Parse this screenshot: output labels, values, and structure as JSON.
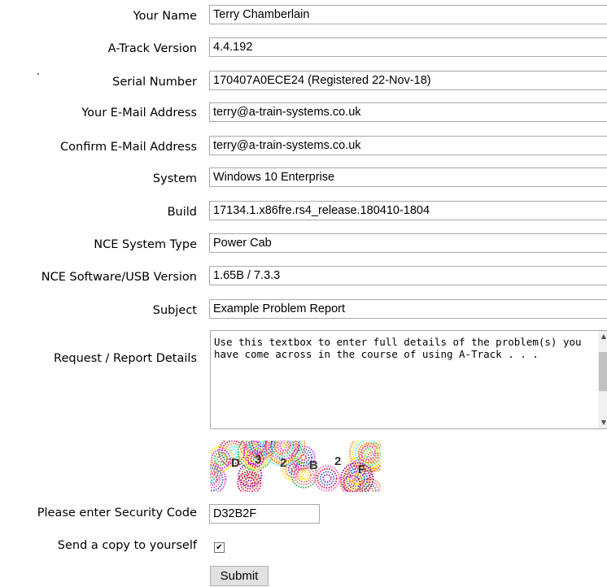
{
  "form": {
    "fields": [
      {
        "label": "Your Name",
        "value": "Terry Chamberlain"
      },
      {
        "label": "A-Track Version",
        "value": "4.4.192"
      },
      {
        "label": "Serial Number",
        "value": "170407A0ECE24 (Registered 22-Nov-18)"
      },
      {
        "label": "Your E-Mail Address",
        "value": "terry@a-train-systems.co.uk"
      },
      {
        "label": "Confirm E-Mail Address",
        "value": "terry@a-train-systems.co.uk"
      },
      {
        "label": "System",
        "value": "Windows 10 Enterprise"
      },
      {
        "label": "Build",
        "value": "17134.1.x86fre.rs4_release.180410-1804"
      },
      {
        "label": "NCE System Type",
        "value": "Power Cab"
      },
      {
        "label": "NCE Software/USB Version",
        "value": "1.65B / 7.3.3"
      },
      {
        "label": "Subject",
        "value": "Example Problem Report"
      }
    ],
    "details": {
      "label": "Request / Report Details",
      "value": "Use this textbox to enter full details of the problem(s) you have come across in the course of using A-Track . . ."
    },
    "captcha": {
      "characters": [
        "D",
        "3",
        "2",
        "B",
        "2",
        "F"
      ],
      "colors": [
        "#e6194b",
        "#3cb44b",
        "#ffe119",
        "#4363d8",
        "#f58231",
        "#911eb4",
        "#46f0f0",
        "#f032e6",
        "#bcf60c",
        "#ff69b4"
      ]
    },
    "security": {
      "label": "Please enter Security Code",
      "value": "D32B2F"
    },
    "copy": {
      "label": "Send a copy to yourself",
      "checked": true,
      "check_glyph": "✔"
    },
    "submit_label": "Submit"
  }
}
